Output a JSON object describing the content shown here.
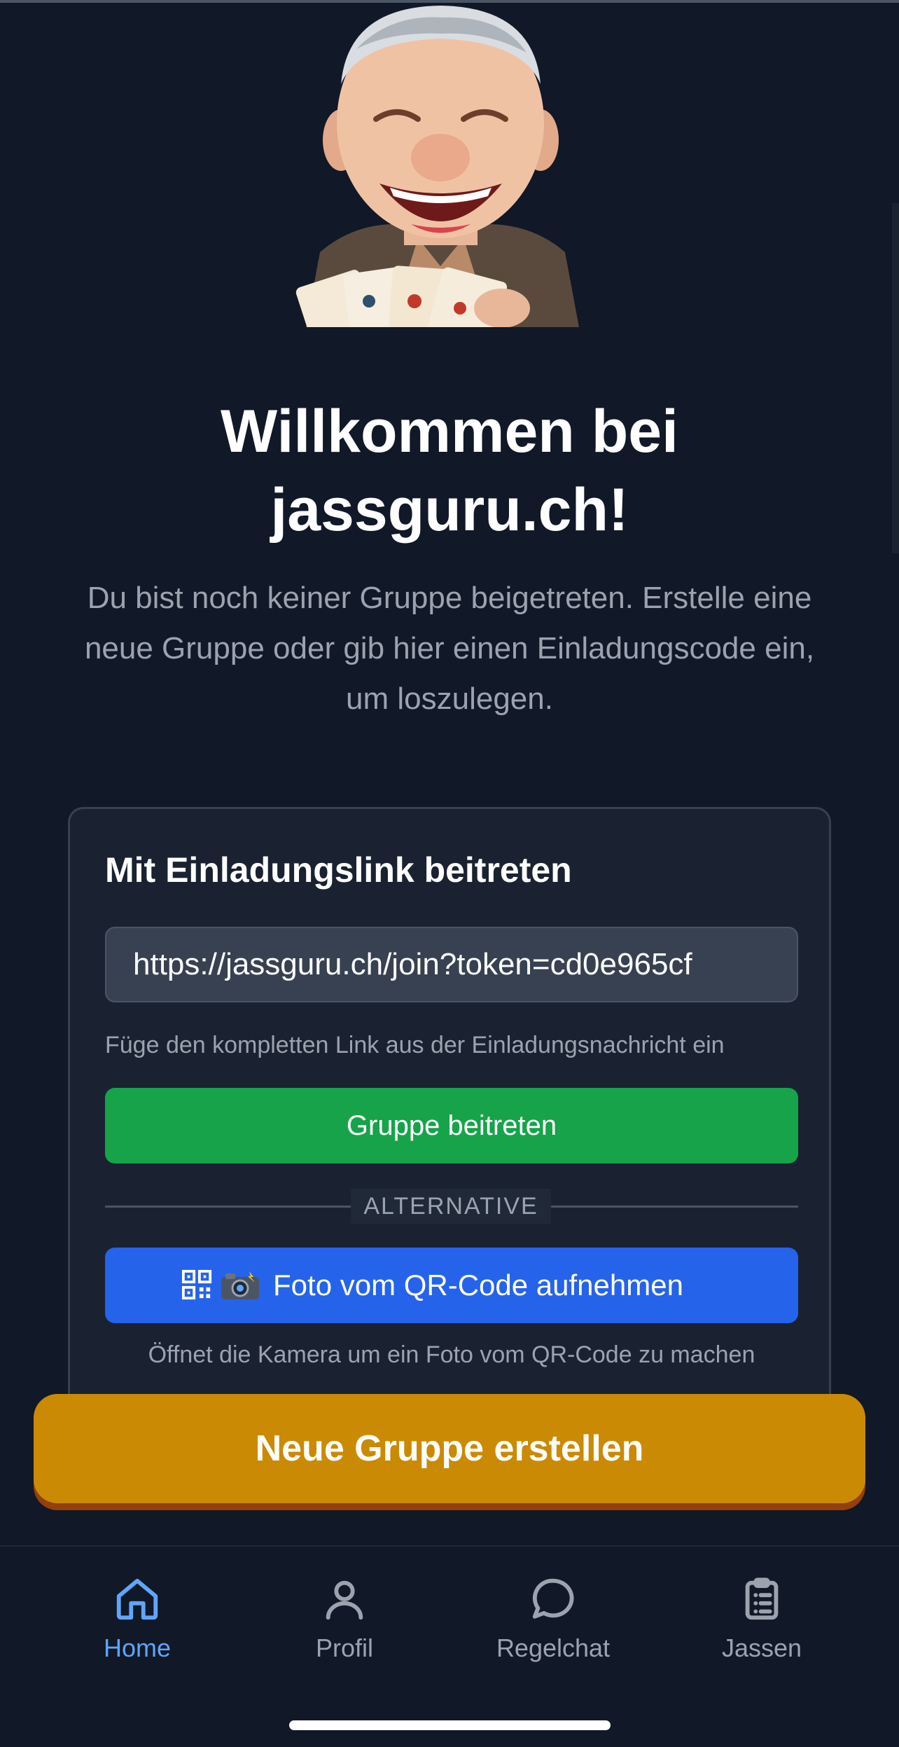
{
  "welcome": {
    "title_line1": "Willkommen bei",
    "title_line2": "jassguru.ch!",
    "subtitle": "Du bist noch keiner Gruppe beigetreten. Erstelle eine neue Gruppe oder gib hier einen Einladungscode ein, um loszulegen."
  },
  "join_card": {
    "title": "Mit Einladungslink beitreten",
    "link_value": "https://jassguru.ch/join?token=cd0e965cf",
    "hint": "Füge den kompletten Link aus der Einladungsnachricht ein",
    "join_button": "Gruppe beitreten",
    "divider_label": "ALTERNATIVE",
    "qr_button": "Foto vom QR-Code aufnehmen",
    "qr_hint": "Öffnet die Kamera um ein Foto vom QR-Code zu machen"
  },
  "create_button": "Neue Gruppe erstellen",
  "nav": {
    "items": [
      {
        "label": "Home",
        "icon": "home-icon",
        "active": true
      },
      {
        "label": "Profil",
        "icon": "user-icon",
        "active": false
      },
      {
        "label": "Regelchat",
        "icon": "chat-bubble-icon",
        "active": false
      },
      {
        "label": "Jassen",
        "icon": "clipboard-list-icon",
        "active": false
      }
    ]
  },
  "colors": {
    "background": "#111827",
    "card": "#1a2231",
    "join_green": "#16a34a",
    "qr_blue": "#2563eb",
    "create_gold": "#ca8a04",
    "active_nav": "#60a5fa",
    "muted_text": "#9ca3af"
  }
}
